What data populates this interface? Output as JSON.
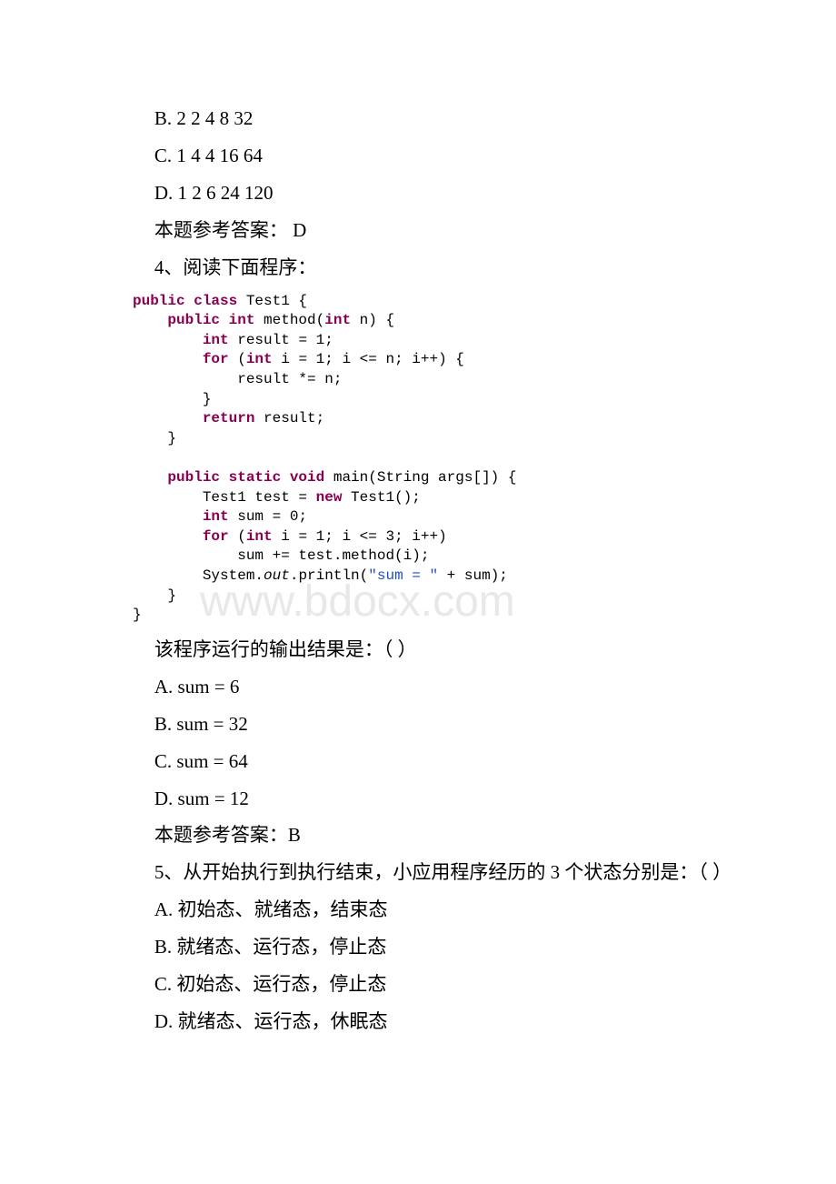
{
  "watermark": "www.bdocx.com",
  "q3_options": {
    "b": " B. 2 2 4 8 32",
    "c": " C. 1 4 4 16 64",
    "d": " D. 1 2 6 24 120"
  },
  "q3_answer": "本题参考答案： D",
  "q4_prompt": "4、阅读下面程序：",
  "code": {
    "l1_a": "public class",
    "l1_b": " Test1 {",
    "l2_a": "    public int",
    "l2_b": " method(",
    "l2_c": "int",
    "l2_d": " n) {",
    "l3_a": "        int",
    "l3_b": " result = 1;",
    "l4_a": "        for",
    "l4_b": " (",
    "l4_c": "int",
    "l4_d": " i = 1; i <= n; i++) {",
    "l5": "            result *= n;",
    "l6": "        }",
    "l7_a": "        return",
    "l7_b": " result;",
    "l8": "    }",
    "blank": "",
    "l9_a": "    public static void",
    "l9_b": " main(String args[]) {",
    "l10_a": "        Test1 test = ",
    "l10_b": "new",
    "l10_c": " Test1();",
    "l11_a": "        int",
    "l11_b": " sum = 0;",
    "l12_a": "        for",
    "l12_b": " (",
    "l12_c": "int",
    "l12_d": " i = 1; i <= 3; i++)",
    "l13": "            sum += test.method(i);",
    "l14_a": "        System.",
    "l14_b": "out",
    "l14_c": ".println(",
    "l14_d": "\"sum = \"",
    "l14_e": " + sum);",
    "l15": "    }",
    "l16": "}"
  },
  "q4_question": "该程序运行的输出结果是：（ ）",
  "q4_options": {
    "a": " A. sum = 6",
    "b": " B. sum = 32",
    "c": " C. sum = 64",
    "d": " D. sum = 12"
  },
  "q4_answer": "本题参考答案：B",
  "q5_prompt": "5、从开始执行到执行结束，小应用程序经历的 3 个状态分别是：（ ）",
  "q5_options": {
    "a": " A. 初始态、就绪态，结束态",
    "b": " B. 就绪态、运行态，停止态",
    "c": " C. 初始态、运行态，停止态",
    "d": " D. 就绪态、运行态，休眠态"
  }
}
